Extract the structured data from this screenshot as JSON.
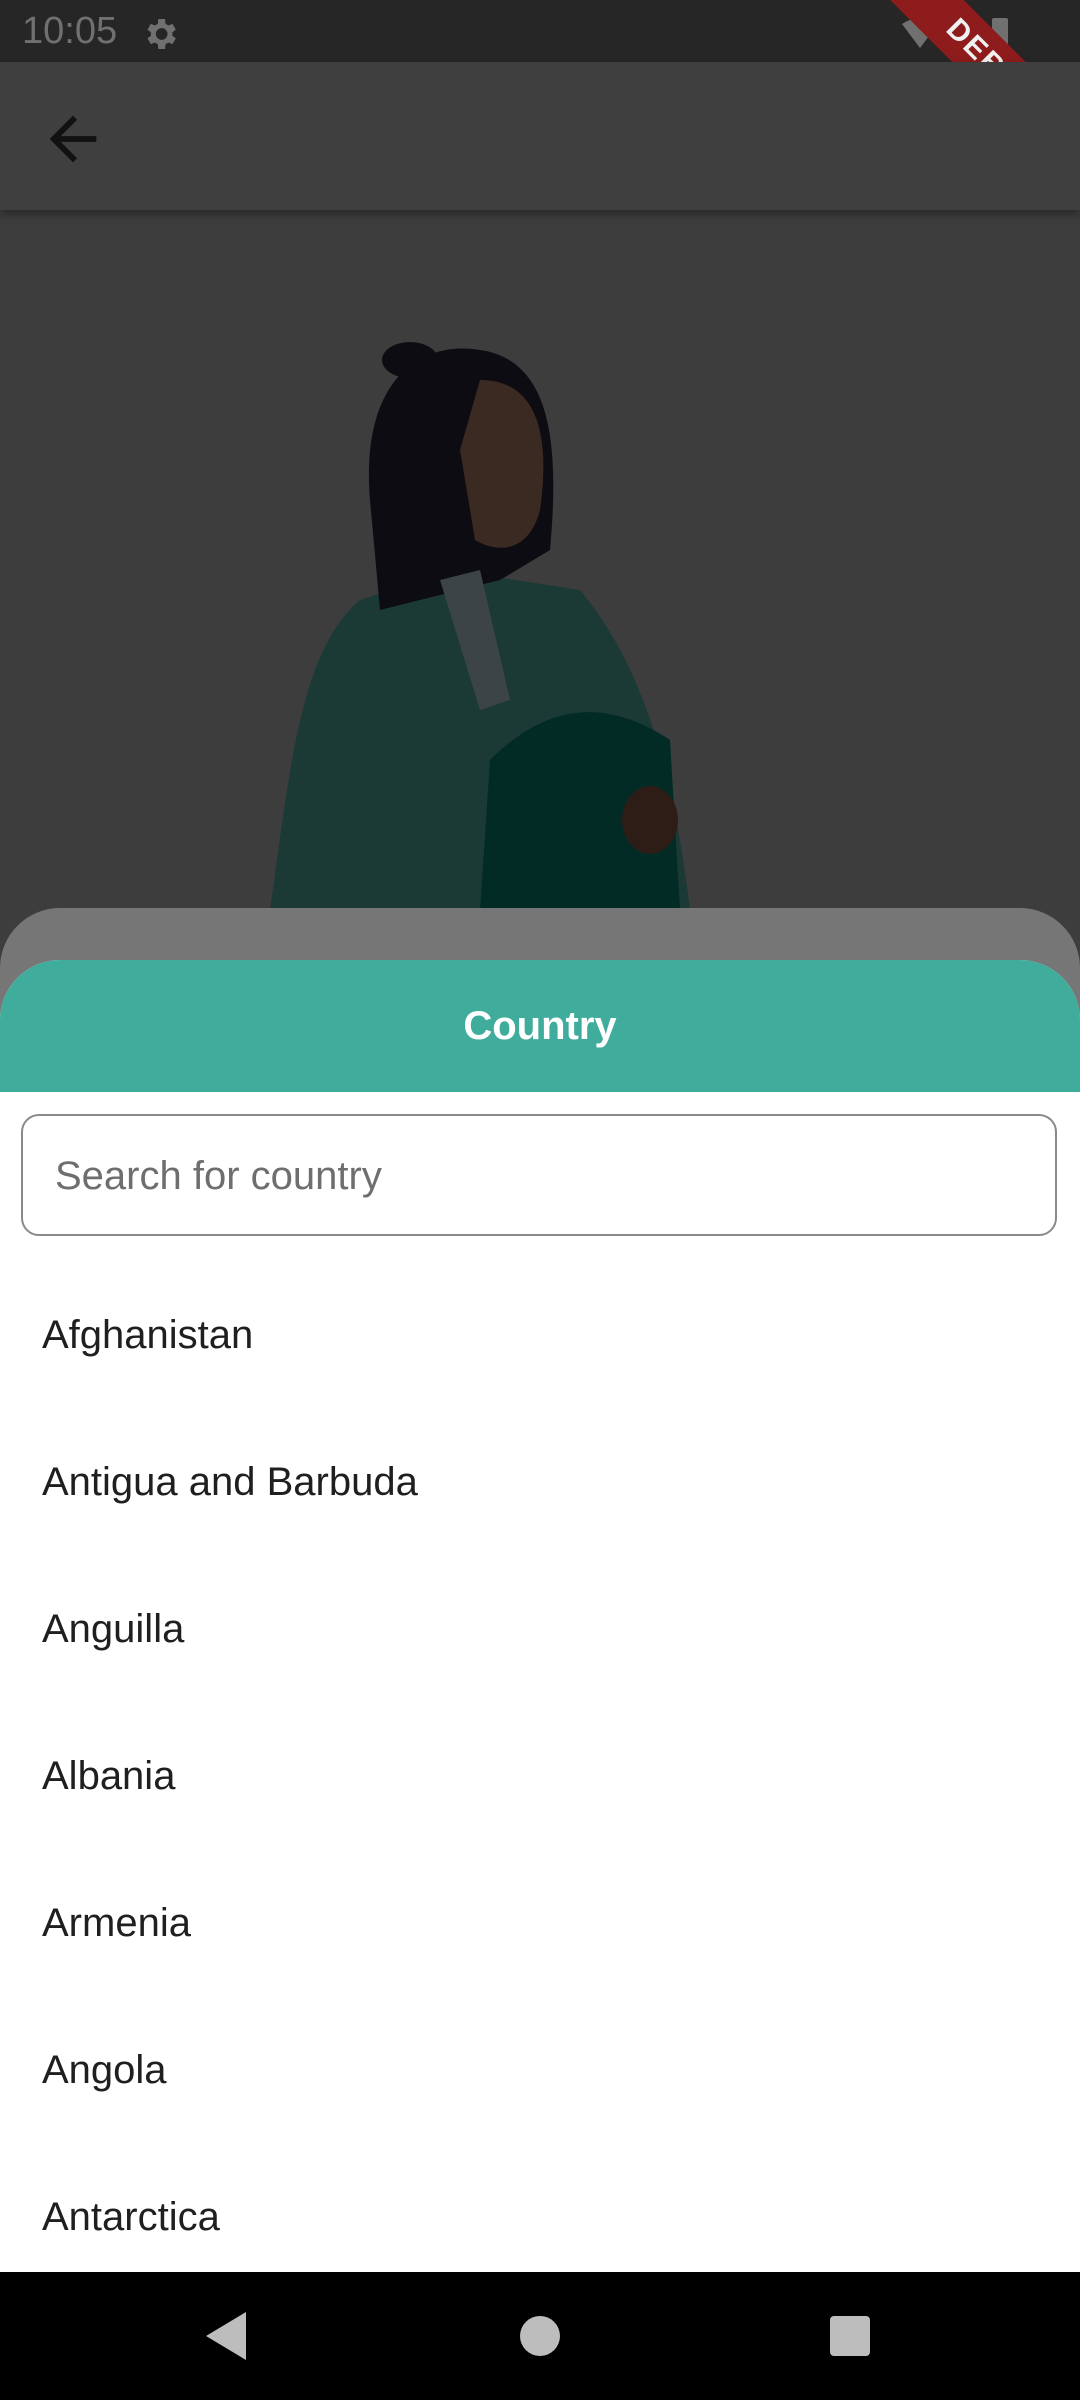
{
  "status_bar": {
    "time": "10:05",
    "icons": [
      "gear-icon",
      "wifi-icon",
      "signal-icon",
      "battery-icon"
    ]
  },
  "debug_banner": {
    "label": "DEBUG"
  },
  "app_bar": {
    "back_icon": "arrow-back-icon"
  },
  "sheet": {
    "title": "Country",
    "search": {
      "placeholder": "Search for country",
      "value": ""
    },
    "countries": [
      "Afghanistan",
      "Antigua and Barbuda",
      "Anguilla",
      "Albania",
      "Armenia",
      "Angola",
      "Antarctica"
    ]
  },
  "colors": {
    "header_accent": "#40ac9c",
    "debug_banner": "#8e1c1c",
    "scrim": "#3d3d3d"
  },
  "nav_bar": {
    "icons": [
      "nav-back-icon",
      "nav-home-icon",
      "nav-recents-icon"
    ]
  }
}
